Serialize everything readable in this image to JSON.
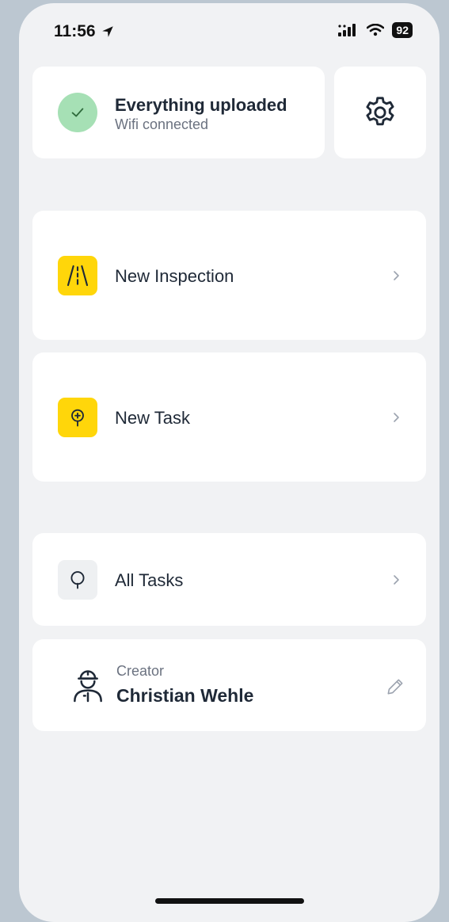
{
  "status_bar": {
    "time": "11:56",
    "battery": "92"
  },
  "sync": {
    "title": "Everything uploaded",
    "subtitle": "Wifi connected",
    "status_color": "#a6e0b5"
  },
  "menu": {
    "new_inspection": "New Inspection",
    "new_task": "New Task",
    "all_tasks": "All Tasks"
  },
  "creator": {
    "label": "Creator",
    "name": "Christian Wehle"
  },
  "colors": {
    "accent": "#ffd60a",
    "background": "#f1f2f4"
  },
  "icons": [
    "location-arrow-icon",
    "signal-icon",
    "wifi-icon",
    "battery-icon",
    "check-icon",
    "gear-icon",
    "road-icon",
    "pin-plus-icon",
    "pin-icon",
    "worker-icon",
    "pencil-icon",
    "chevron-right-icon"
  ]
}
